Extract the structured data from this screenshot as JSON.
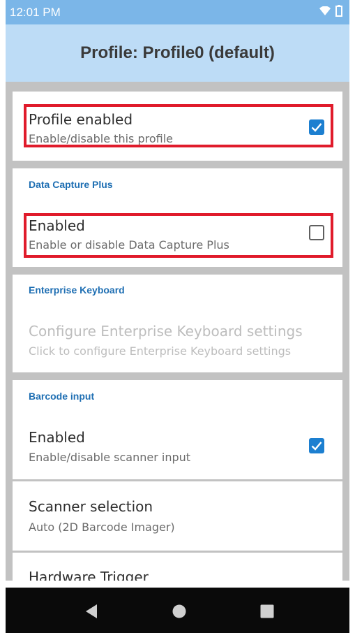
{
  "status_bar": {
    "time": "12:01 PM",
    "icons": [
      "wifi-icon",
      "battery-icon"
    ]
  },
  "app_bar": {
    "title": "Profile: Profile0 (default)"
  },
  "profile_card": {
    "title": "Profile enabled",
    "summary": "Enable/disable this profile",
    "checked": true
  },
  "data_capture_plus": {
    "header": "Data Capture Plus",
    "enabled_title": "Enabled",
    "enabled_summary": "Enable or disable Data Capture Plus",
    "checked": false
  },
  "enterprise_keyboard": {
    "header": "Enterprise Keyboard",
    "configure_title": "Configure Enterprise Keyboard settings",
    "configure_summary": "Click to configure Enterprise Keyboard settings"
  },
  "barcode_input": {
    "header": "Barcode input",
    "enabled_title": "Enabled",
    "enabled_summary": "Enable/disable scanner input",
    "checked": true,
    "scanner_selection_title": "Scanner selection",
    "scanner_selection_summary": "Auto (2D Barcode Imager)",
    "hardware_trigger_title": "Hardware Trigger"
  },
  "nav_bar": {
    "buttons": [
      "back-icon",
      "home-icon",
      "recents-icon"
    ]
  },
  "colors": {
    "status_bar": "#7bb6e8",
    "app_bar": "#bddcf6",
    "accent": "#1c7fd0",
    "section_header": "#1f6fb3",
    "highlight": "#e01b2b"
  }
}
